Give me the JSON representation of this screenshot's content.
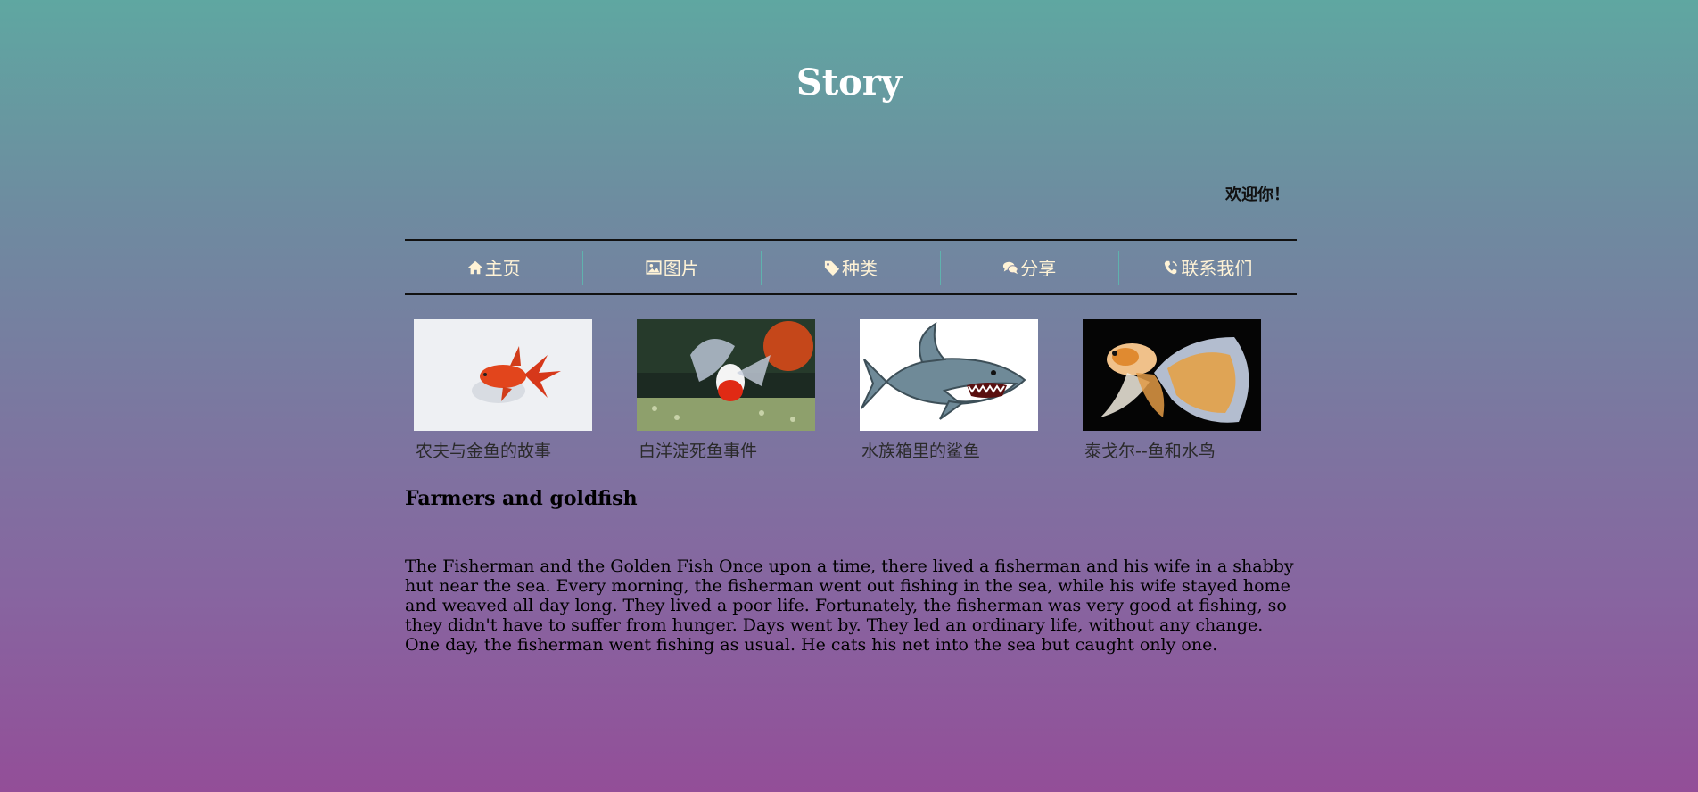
{
  "header": {
    "title": "Story",
    "welcome": "欢迎你！"
  },
  "nav": {
    "items": [
      {
        "label": "主页",
        "icon": "home-icon"
      },
      {
        "label": "图片",
        "icon": "image-icon"
      },
      {
        "label": "种类",
        "icon": "tag-icon"
      },
      {
        "label": "分享",
        "icon": "comments-icon"
      },
      {
        "label": "联系我们",
        "icon": "phone-icon"
      }
    ]
  },
  "gallery": {
    "items": [
      {
        "caption": "农夫与金鱼的故事",
        "image": "red-goldfish-image"
      },
      {
        "caption": "白洋淀死鱼事件",
        "image": "aquarium-goldfish-image"
      },
      {
        "caption": "水族箱里的鲨鱼",
        "image": "shark-image"
      },
      {
        "caption": "泰戈尔--鱼和水鸟",
        "image": "betta-fish-image"
      }
    ]
  },
  "story": {
    "heading": "Farmers and goldfish",
    "body": "The Fisherman and the Golden Fish Once upon a time, there lived a fisherman and his wife in a shabby hut near the sea. Every morning, the fisherman went out fishing in the sea, while his wife stayed home and weaved all day long. They lived a poor life. Fortunately, the fisherman was very good at fishing, so they didn't have to suffer from hunger. Days went by. They led an ordinary life, without any change. One day, the fisherman went fishing as usual. He cats his net into the sea but caught only one."
  },
  "colors": {
    "gradient_top": "#5fa7a1",
    "gradient_bottom": "#934e98",
    "nav_text": "#fff3d6",
    "nav_divider": "#5fb2ae"
  }
}
